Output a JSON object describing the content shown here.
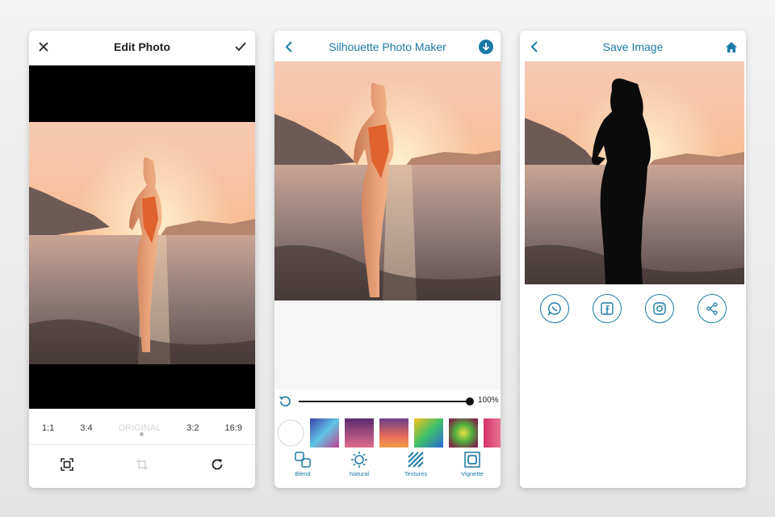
{
  "colors": {
    "accent": "#1a7aa6",
    "background": "#ececec"
  },
  "screen1": {
    "title": "Edit Photo",
    "close_icon": "close-icon",
    "confirm_icon": "check-icon",
    "ratios": [
      "1:1",
      "3:4",
      "ORIGINAL",
      "3:2",
      "16:9"
    ],
    "tools": [
      "crop-fit-icon",
      "crop-free-icon",
      "rotate-icon"
    ]
  },
  "screen2": {
    "title": "Silhouette Photo Maker",
    "back_icon": "chevron-left-icon",
    "download_icon": "download-icon",
    "opacity_value": "100%",
    "opacity_fraction": 1.0,
    "tabs": [
      {
        "label": "Blend",
        "icon": "blend-icon"
      },
      {
        "label": "Natural",
        "icon": "sun-icon"
      },
      {
        "label": "Textures",
        "icon": "texture-icon"
      },
      {
        "label": "Vignette",
        "icon": "vignette-icon"
      }
    ]
  },
  "screen3": {
    "title": "Save Image",
    "back_icon": "chevron-left-icon",
    "home_icon": "home-icon",
    "share_buttons": [
      "whatsapp-icon",
      "facebook-icon",
      "instagram-icon",
      "share-icon"
    ]
  }
}
